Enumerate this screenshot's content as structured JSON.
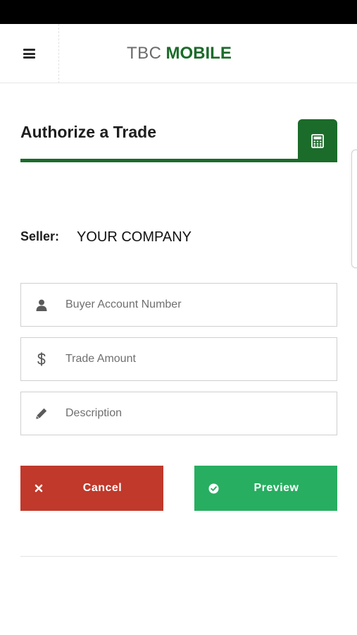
{
  "header": {
    "brand_primary": "TBC",
    "brand_secondary": "MOBILE",
    "brand_color": "#1b6b2a",
    "menu_icon": "hamburger-icon"
  },
  "page": {
    "title": "Authorize a Trade",
    "calculator_icon": "calculator-icon"
  },
  "seller": {
    "label": "Seller:",
    "value": "YOUR COMPANY"
  },
  "form": {
    "fields": [
      {
        "icon": "user-icon",
        "placeholder": "Buyer Account Number",
        "value": ""
      },
      {
        "icon": "dollar-icon",
        "placeholder": "Trade Amount",
        "value": ""
      },
      {
        "icon": "pencil-icon",
        "placeholder": "Description",
        "value": ""
      }
    ]
  },
  "actions": {
    "cancel": {
      "label": "Cancel",
      "icon": "times-icon",
      "color": "#c0392b"
    },
    "preview": {
      "label": "Preview",
      "icon": "check-circle-icon",
      "color": "#27ae60"
    }
  }
}
